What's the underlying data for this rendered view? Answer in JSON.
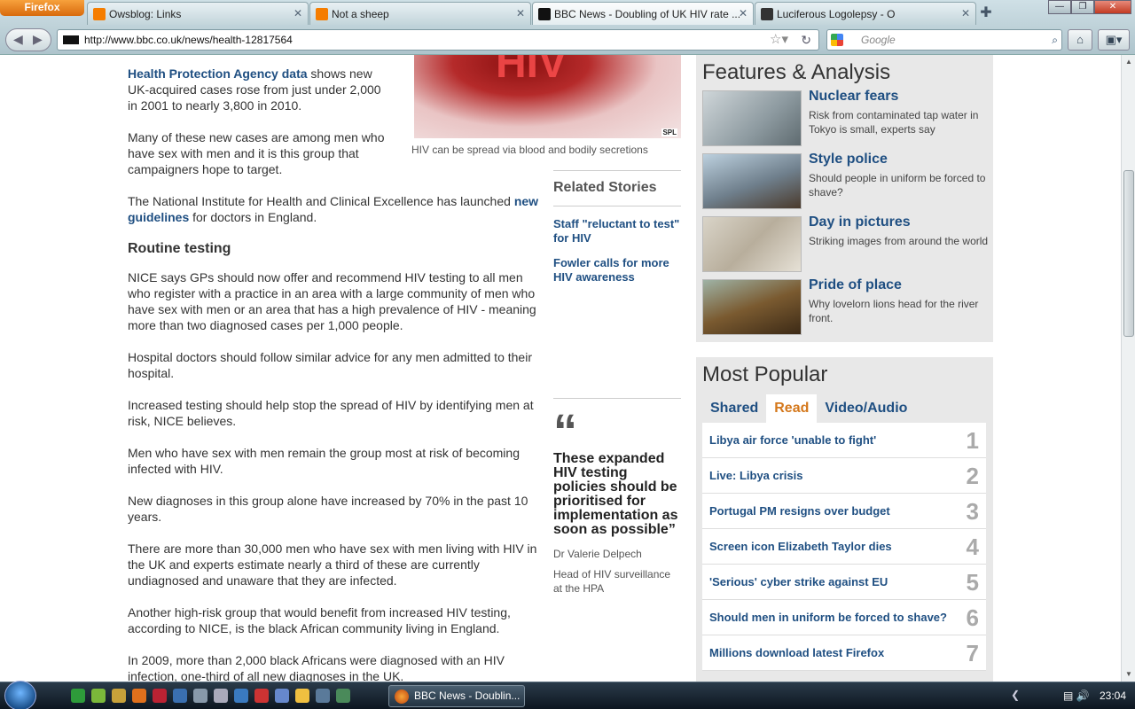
{
  "browser": {
    "firefox_label": "Firefox",
    "tabs": [
      {
        "title": "Owsblog: Links",
        "favicon_color": "#f57d00"
      },
      {
        "title": "Not a sheep",
        "favicon_color": "#f57d00"
      },
      {
        "title": "BBC News - Doubling of UK HIV rate ...",
        "favicon_color": "#111111"
      },
      {
        "title": "Luciferous Logolepsy - O",
        "favicon_color": "#333333"
      }
    ],
    "url": "http://www.bbc.co.uk/news/health-12817564",
    "search_placeholder": "Google"
  },
  "article": {
    "p1_link": "Health Protection Agency data",
    "p1_text": " shows new UK-acquired cases rose from just under 2,000 in 2001 to nearly 3,800 in 2010.",
    "p2": "Many of these new cases are among men who have sex with men and it is this group that campaigners hope to target.",
    "p3_text": "The National Institute for Health and Clinical Excellence has launched ",
    "p3_link": "new guidelines",
    "p3_tail": " for doctors in England.",
    "subheading": "Routine testing",
    "p4": "NICE says GPs should now offer and recommend HIV testing to all men who register with a practice in an area with a large community of men who have sex with men or an area that has a high prevalence of HIV - meaning more than two diagnosed cases per 1,000 people.",
    "p5": "Hospital doctors should follow similar advice for any men admitted to their hospital.",
    "p6": "Increased testing should help stop the spread of HIV by identifying men at risk, NICE believes.",
    "p7": "Men who have sex with men remain the group most at risk of becoming infected with HIV.",
    "p8": "New diagnoses in this group alone have increased by 70% in the past 10 years.",
    "p9": "There are more than 30,000 men who have sex with men living with HIV in the UK and experts estimate nearly a third of these are currently undiagnosed and unaware that they are infected.",
    "p10": "Another high-risk group that would benefit from increased HIV testing, according to NICE, is the black African community living in England.",
    "p11": "In 2009, more than 2,000 black Africans were diagnosed with an HIV infection, one-third of all new diagnoses in the UK."
  },
  "figure": {
    "image_text": "HIV",
    "credit": "SPL",
    "caption": "HIV can be spread via blood and bodily secretions"
  },
  "related": {
    "heading": "Related Stories",
    "links": [
      "Staff \"reluctant to test\" for HIV",
      "Fowler calls for more HIV awareness"
    ]
  },
  "quote": {
    "mark": "“",
    "text": "These expanded HIV testing policies should be prioritised for implementation as soon as possible”",
    "name": "Dr Valerie Delpech",
    "role": "Head of HIV surveillance at the HPA"
  },
  "features": {
    "heading": "Features & Analysis",
    "items": [
      {
        "title": "Nuclear fears",
        "desc": "Risk from contaminated tap water in Tokyo is small, experts say",
        "thumb_color": "#9aa7ad"
      },
      {
        "title": "Style police",
        "desc": "Should people in uniform be forced to shave?",
        "thumb_color": "#7d8f9e"
      },
      {
        "title": "Day in pictures",
        "desc": "Striking images from around the world",
        "thumb_color": "#c9c2b6"
      },
      {
        "title": "Pride of place",
        "desc": "Why lovelorn lions head for the river front.",
        "thumb_color": "#8a6a3a"
      }
    ]
  },
  "popular": {
    "heading": "Most Popular",
    "tabs": [
      "Shared",
      "Read",
      "Video/Audio"
    ],
    "items": [
      {
        "title": "Libya air force 'unable to fight'",
        "num": "1"
      },
      {
        "title": "Live: Libya crisis",
        "num": "2"
      },
      {
        "title": "Portugal PM resigns over budget",
        "num": "3"
      },
      {
        "title": "Screen icon Elizabeth Taylor dies",
        "num": "4"
      },
      {
        "title": "'Serious' cyber strike against EU",
        "num": "5"
      },
      {
        "title": "Should men in uniform be forced to shave?",
        "num": "6"
      },
      {
        "title": "Millions download latest Firefox",
        "num": "7"
      }
    ]
  },
  "taskbar": {
    "task_label": "BBC News - Doublin...",
    "clock": "23:04"
  }
}
